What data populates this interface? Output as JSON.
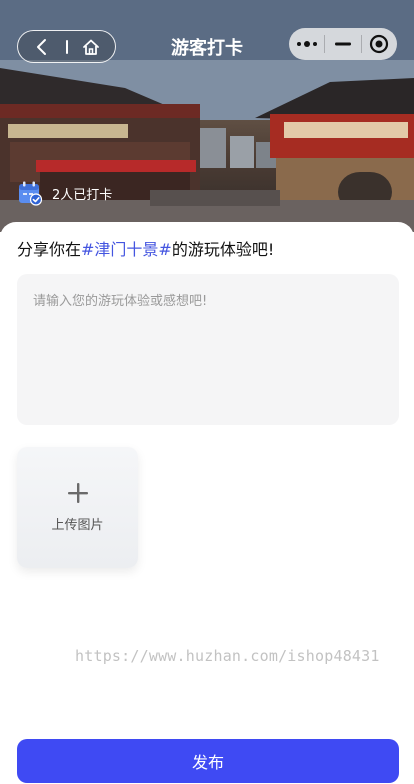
{
  "header": {
    "title": "游客打卡",
    "back_icon": "chevron-left-icon",
    "home_icon": "home-icon",
    "menu_icon": "more-dots-icon",
    "minimize_icon": "minimize-icon",
    "close_icon": "target-circle-icon"
  },
  "hero": {
    "checkin_icon": "calendar-check-icon",
    "checkin_text": "2人已打卡"
  },
  "post": {
    "prompt_prefix": "分享你在",
    "topic": "#津门十景#",
    "prompt_suffix": "的游玩体验吧!",
    "placeholder": "请输入您的游玩体验或感想吧!"
  },
  "upload": {
    "label": "上传图片",
    "icon": "plus-icon"
  },
  "watermark": "https://www.huzhan.com/ishop48431",
  "publish_label": "发布",
  "colors": {
    "accent": "#3f4af3",
    "topic": "#4455e0",
    "input_bg": "#f5f5f6"
  }
}
